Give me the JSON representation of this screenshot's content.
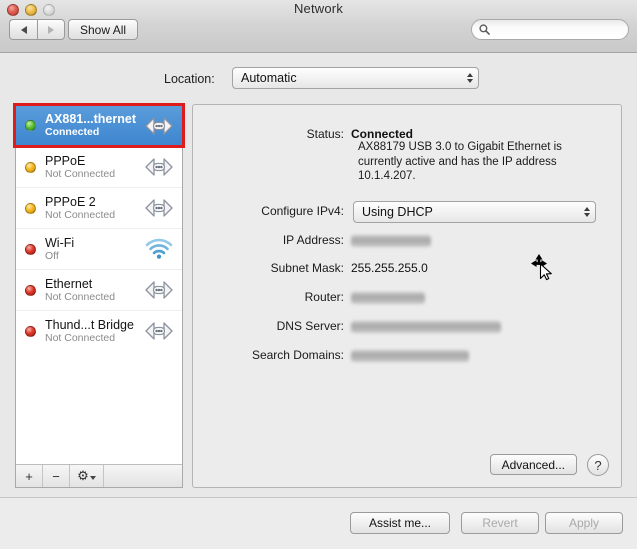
{
  "window": {
    "title": "Network",
    "traffic_lights": [
      "close",
      "minimize",
      "zoom"
    ],
    "back_label": "◀",
    "forward_label": "▶",
    "show_all_label": "Show All",
    "search_placeholder": "",
    "search_value": "",
    "search_icon": "search-icon"
  },
  "location": {
    "label": "Location:",
    "value": "Automatic"
  },
  "sidebar": {
    "services": [
      {
        "name": "AX881...thernet",
        "status": "Connected",
        "dot": "green",
        "icon": "ethernet-port-icon",
        "selected": true
      },
      {
        "name": "PPPoE",
        "status": "Not Connected",
        "dot": "amber",
        "icon": "ethernet-port-icon",
        "selected": false
      },
      {
        "name": "PPPoE 2",
        "status": "Not Connected",
        "dot": "amber",
        "icon": "ethernet-port-icon",
        "selected": false
      },
      {
        "name": "Wi-Fi",
        "status": "Off",
        "dot": "red",
        "icon": "wifi-icon",
        "selected": false
      },
      {
        "name": "Ethernet",
        "status": "Not Connected",
        "dot": "red",
        "icon": "ethernet-port-icon",
        "selected": false
      },
      {
        "name": "Thund...t Bridge",
        "status": "Not Connected",
        "dot": "red",
        "icon": "ethernet-port-icon",
        "selected": false
      }
    ],
    "footer": {
      "add_label": "+",
      "remove_label": "−",
      "gear_label": "⚙"
    }
  },
  "detail": {
    "status_label": "Status:",
    "status_value": "Connected",
    "status_description": "AX88179 USB 3.0 to Gigabit Ethernet is currently active and has the IP address 10.1.4.207.",
    "configure_ipv4_label": "Configure IPv4:",
    "configure_ipv4_value": "Using DHCP",
    "ip_address_label": "IP Address:",
    "ip_address_value": "",
    "ip_address_redacted": true,
    "subnet_mask_label": "Subnet Mask:",
    "subnet_mask_value": "255.255.255.0",
    "router_label": "Router:",
    "router_value": "",
    "router_redacted": true,
    "dns_server_label": "DNS Server:",
    "dns_server_value": "",
    "dns_server_redacted": true,
    "search_domains_label": "Search Domains:",
    "search_domains_value": "",
    "search_domains_redacted": true,
    "advanced_label": "Advanced...",
    "help_label": "?"
  },
  "bottom": {
    "assist_me_label": "Assist me...",
    "revert_label": "Revert",
    "revert_disabled": true,
    "apply_label": "Apply",
    "apply_disabled": true
  },
  "annotation": {
    "highlight_color": "#e01b1b",
    "target": "AX881...thernet"
  },
  "colors": {
    "selection_blue": "#3d85cf",
    "panel_bg": "#ececec",
    "window_bg": "#e8e8e8"
  }
}
